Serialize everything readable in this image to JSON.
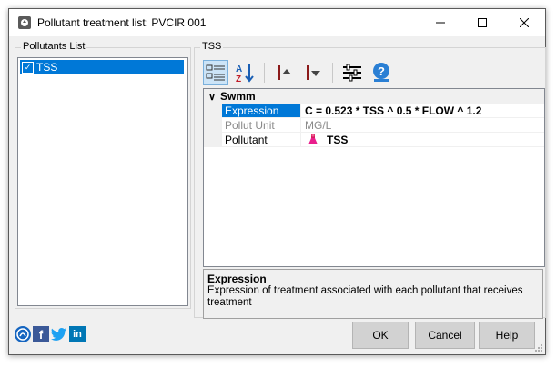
{
  "window": {
    "title": "Pollutant treatment list: PVCIR 001",
    "minimize": "—",
    "maximize": "☐",
    "close": "✕"
  },
  "pollutants_list": {
    "label": "Pollutants List",
    "items": [
      {
        "label": "TSS",
        "checked": true,
        "selected": true
      }
    ]
  },
  "tss_panel": {
    "label": "TSS",
    "toolbar": {
      "buttons": [
        "categorized-icon",
        "sort-az-icon",
        "move-up-icon",
        "move-down-icon",
        "settings-sliders-icon",
        "help-globe-icon"
      ]
    },
    "grid": {
      "category": "Swmm",
      "rows": [
        {
          "name": "Expression",
          "value": "C = 0.523 * TSS ^ 0.5 * FLOW ^ 1.2"
        },
        {
          "name": "Pollut Unit",
          "value": "MG/L"
        },
        {
          "name": "Pollutant",
          "value": "TSS"
        }
      ]
    },
    "help": {
      "title": "Expression",
      "description": "Expression of treatment associated with each pollutant that receives treatment"
    }
  },
  "buttons": {
    "ok": "OK",
    "cancel": "Cancel",
    "help": "Help"
  },
  "social": {
    "facebook": "f",
    "linkedin": "in"
  },
  "colors": {
    "selection": "#0078d7",
    "button_bg": "#d2d2d2",
    "dialog_bg": "#f0f0f0"
  }
}
